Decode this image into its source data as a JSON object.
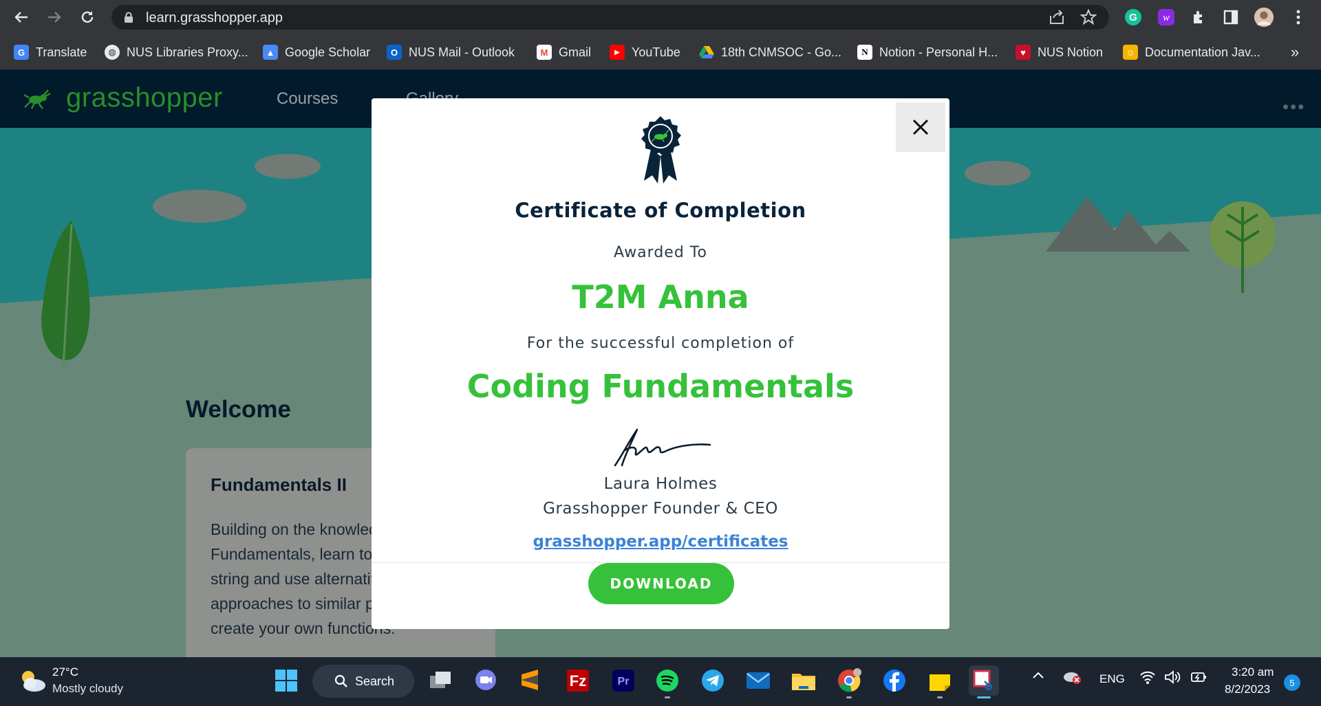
{
  "browser": {
    "url": "learn.grasshopper.app",
    "bookmarks": [
      {
        "label": "Translate",
        "icon": "google-translate-icon",
        "color": "#4285f4"
      },
      {
        "label": "NUS Libraries Proxy...",
        "icon": "globe-icon",
        "color": "#e8eaed"
      },
      {
        "label": "Google Scholar",
        "icon": "scholar-icon",
        "color": "#4a8af4"
      },
      {
        "label": "NUS Mail - Outlook",
        "icon": "outlook-icon",
        "color": "#0a64c8"
      },
      {
        "label": "Gmail",
        "icon": "gmail-icon",
        "color": "#ea4335"
      },
      {
        "label": "YouTube",
        "icon": "youtube-icon",
        "color": "#ff0000"
      },
      {
        "label": "18th CNMSOC - Go...",
        "icon": "google-drive-icon",
        "color": "#1fa463"
      },
      {
        "label": "Notion - Personal H...",
        "icon": "notion-icon",
        "color": "#ffffff"
      },
      {
        "label": "NUS Notion",
        "icon": "nus-notion-icon",
        "color": "#c8102e"
      },
      {
        "label": "Documentation Jav...",
        "icon": "doc-person-icon",
        "color": "#f4b400"
      }
    ],
    "more_bookmarks": "»"
  },
  "site": {
    "logo": "grasshopper",
    "nav": [
      "Courses",
      "Gallery"
    ],
    "kebab": "•••",
    "welcome": "Welcome",
    "course_card": {
      "title": "Fundamentals II",
      "description": "Building on the knowledge gained in Fundamentals, learn to manipulate string and use alternative approaches to similar problems and create your own functions."
    }
  },
  "modal": {
    "close_label": "×",
    "title": "Certificate of Completion",
    "awarded_to": "Awarded To",
    "recipient": "T2M Anna",
    "for_text": "For the successful completion of",
    "course": "Coding Fundamentals",
    "signer_name": "Laura Holmes",
    "signer_title": "Grasshopper Founder & CEO",
    "link": "grasshopper.app/certificates",
    "download": "DOWNLOAD"
  },
  "taskbar": {
    "weather_temp": "27°C",
    "weather_desc": "Mostly cloudy",
    "search": "Search",
    "language": "ENG",
    "time": "3:20 am",
    "date": "8/2/2023",
    "notification_count": "5"
  },
  "colors": {
    "brand_green": "#36c13a",
    "header_navy": "#02253d",
    "link_blue": "#3b83d6"
  }
}
